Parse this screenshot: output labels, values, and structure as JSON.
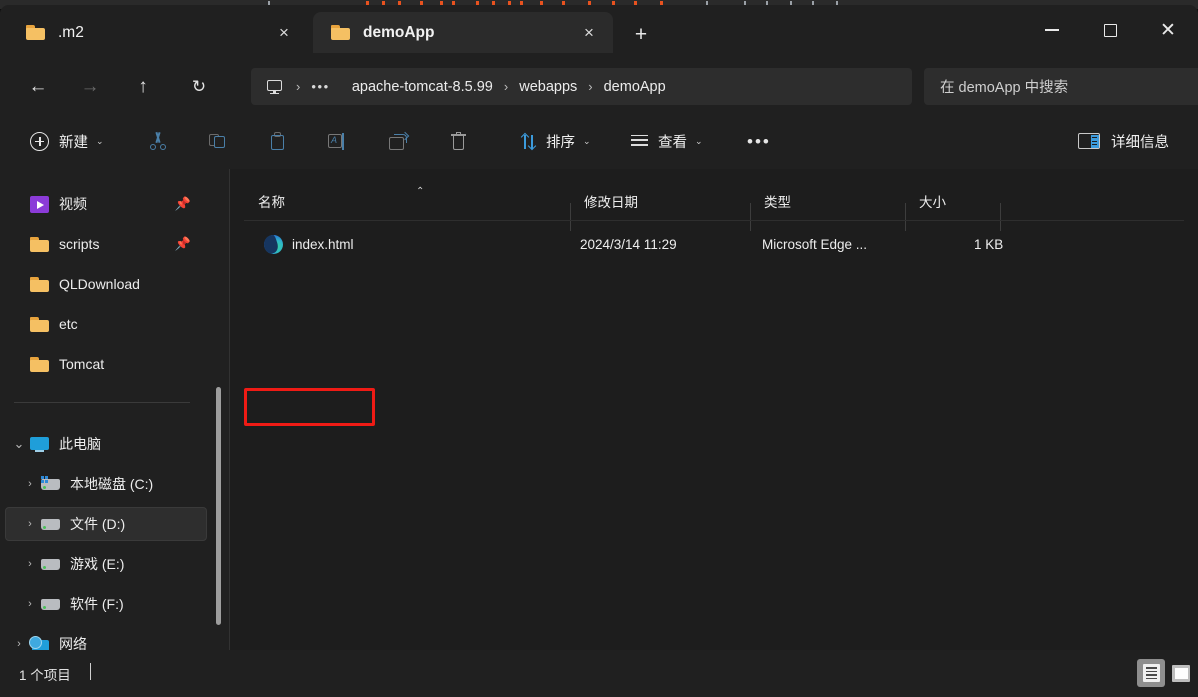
{
  "window": {
    "controls": {
      "minimize": "minimize-button",
      "maximize": "maximize-button",
      "close": "close-button"
    }
  },
  "tabs": {
    "items": [
      {
        "label": ".m2",
        "icon": "folder-icon",
        "active": false,
        "close": "×"
      },
      {
        "label": "demoApp",
        "icon": "folder-icon",
        "active": true,
        "close": "×"
      }
    ],
    "new_tab": "+"
  },
  "navbar": {
    "back": "←",
    "forward": "→",
    "up": "↑",
    "refresh": "↻",
    "breadcrumb": {
      "root_icon": "this-pc-icon",
      "overflow": "•••",
      "separator": "›",
      "items": [
        "apache-tomcat-8.5.99",
        "webapps",
        "demoApp"
      ]
    },
    "search": {
      "placeholder": "在 demoApp 中搜索",
      "value": ""
    }
  },
  "toolbar": {
    "new_label": "新建",
    "new_chevron": "⌄",
    "cut_label": "cut-icon",
    "copy_label": "copy-icon",
    "paste_label": "paste-icon",
    "rename_label": "rename-icon",
    "share_label": "share-icon",
    "delete_label": "delete-icon",
    "sort_label": "排序",
    "sort_chevron": "⌄",
    "view_label": "查看",
    "view_chevron": "⌄",
    "more_label": "•••",
    "details_label": "详细信息"
  },
  "sidebar": {
    "items": [
      {
        "label": "视频",
        "icon": "video-folder-icon",
        "indent": 1,
        "chevron": "",
        "pinned": true,
        "pin": "📌",
        "selected": false
      },
      {
        "label": "scripts",
        "icon": "folder-icon",
        "indent": 1,
        "chevron": "",
        "pinned": true,
        "pin": "📌",
        "selected": false
      },
      {
        "label": "QLDownload",
        "icon": "folder-icon",
        "indent": 1,
        "chevron": "",
        "pinned": false,
        "pin": "",
        "selected": false
      },
      {
        "label": "etc",
        "icon": "folder-icon",
        "indent": 1,
        "chevron": "",
        "pinned": false,
        "pin": "",
        "selected": false
      },
      {
        "label": "Tomcat",
        "icon": "folder-icon",
        "indent": 1,
        "chevron": "",
        "pinned": false,
        "pin": "",
        "selected": false
      },
      {
        "label": "此电脑",
        "icon": "this-pc-icon",
        "indent": 0,
        "chevron": "⌄",
        "pinned": false,
        "pin": "",
        "selected": false
      },
      {
        "label": "本地磁盘 (C:)",
        "icon": "system-drive-icon",
        "indent": 1,
        "chevron": "›",
        "pinned": false,
        "pin": "",
        "selected": false
      },
      {
        "label": "文件 (D:)",
        "icon": "drive-icon",
        "indent": 1,
        "chevron": "›",
        "pinned": false,
        "pin": "",
        "selected": true
      },
      {
        "label": "游戏 (E:)",
        "icon": "drive-icon",
        "indent": 1,
        "chevron": "›",
        "pinned": false,
        "pin": "",
        "selected": false
      },
      {
        "label": "软件 (F:)",
        "icon": "drive-icon",
        "indent": 1,
        "chevron": "›",
        "pinned": false,
        "pin": "",
        "selected": false
      },
      {
        "label": "网络",
        "icon": "network-icon",
        "indent": 0,
        "chevron": "›",
        "pinned": false,
        "pin": "",
        "selected": false
      }
    ]
  },
  "filelist": {
    "columns": [
      {
        "label": "名称",
        "sorted": true
      },
      {
        "label": "修改日期",
        "sorted": false
      },
      {
        "label": "类型",
        "sorted": false
      },
      {
        "label": "大小",
        "sorted": false
      }
    ],
    "sort_caret": "⌃",
    "rows": [
      {
        "name": "index.html",
        "icon": "edge-browser-icon",
        "modified": "2024/3/14 11:29",
        "type": "Microsoft Edge ...",
        "size": "1 KB",
        "highlighted": true
      }
    ]
  },
  "statusbar": {
    "item_count": "1 个项目",
    "views": {
      "details": "details-view-button",
      "large_icons": "large-icons-view-button"
    }
  },
  "colors": {
    "window_bg": "#202020",
    "filepane_bg": "#1d1d1d",
    "active_tab": "#2b2b2b",
    "accent": "#3c9bdc",
    "annotation_red": "#ef1b15",
    "folder_yellow": "#f5c063"
  }
}
